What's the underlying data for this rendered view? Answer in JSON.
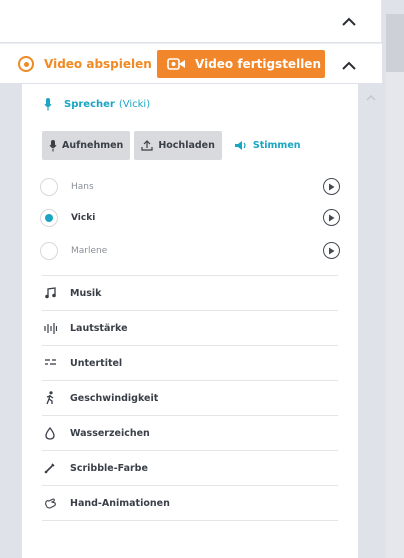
{
  "action_bar": {
    "play_label": "Video abspielen",
    "finish_label": "Video fertigstellen"
  },
  "speaker": {
    "title": "Sprecher",
    "current": "(Vicki)",
    "record_label": "Aufnehmen",
    "upload_label": "Hochladen",
    "voices_label": "Stimmen",
    "voices": [
      {
        "name": "Hans",
        "selected": false
      },
      {
        "name": "Vicki",
        "selected": true
      },
      {
        "name": "Marlene",
        "selected": false
      }
    ]
  },
  "sections": [
    {
      "label": "Musik",
      "icon": "music-note-icon"
    },
    {
      "label": "Lautstärke",
      "icon": "volume-levels-icon"
    },
    {
      "label": "Untertitel",
      "icon": "subtitles-icon"
    },
    {
      "label": "Geschwindigkeit",
      "icon": "running-person-icon"
    },
    {
      "label": "Wasserzeichen",
      "icon": "watermark-icon"
    },
    {
      "label": "Scribble-Farbe",
      "icon": "pencil-icon"
    },
    {
      "label": "Hand-Animationen",
      "icon": "hand-icon"
    }
  ],
  "colors": {
    "accent_orange": "#f2862a",
    "accent_teal": "#1aa5c2",
    "background": "#dfe2e8"
  }
}
